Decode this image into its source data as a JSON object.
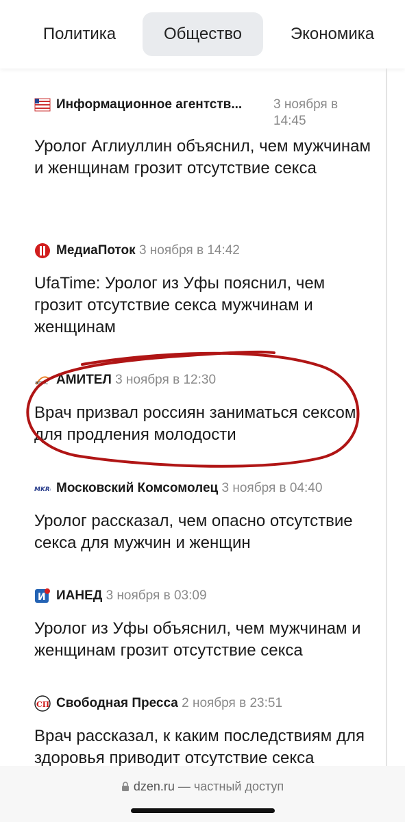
{
  "tabs": [
    {
      "label": "Политика"
    },
    {
      "label": "Общество",
      "active": true
    },
    {
      "label": "Экономика"
    }
  ],
  "news": [
    {
      "source": "Информационное агентств...",
      "time": "3 ноября в 14:45",
      "title": "Уролог Аглиуллин объяснил, чем мужчинам и женщинам грозит отсутствие секса"
    },
    {
      "source": "МедиаПоток",
      "time": "3 ноября в 14:42",
      "title": "UfaTime: Уролог из Уфы пояснил, чем грозит отсутствие секса мужчинам и женщинам"
    },
    {
      "source": "АМИТЕЛ",
      "time": "3 ноября в 12:30",
      "title": "Врач призвал россиян заниматься сексом для продления молодости",
      "logo_text": "amic"
    },
    {
      "source": "Московский Комсомолец",
      "time": "3 ноября в 04:40",
      "title": "Уролог рассказал, чем опасно отсутствие секса для мужчин и женщин",
      "logo_text": "MKRU"
    },
    {
      "source": "ИАНЕД",
      "time": "3 ноября в 03:09",
      "title": "Уролог из Уфы объяснил, чем мужчинам и женщинам грозит отсутствие секса",
      "logo_text": "И"
    },
    {
      "source": "Свободная Пресса",
      "time": "2 ноября в 23:51",
      "title": "Врач рассказал, к каким последствиям для здоровья приводит отсутствие секса",
      "logo_text": "СП"
    }
  ],
  "bottom": {
    "host": "dzen.ru",
    "access": " — частный доступ"
  },
  "colors": {
    "annotation": "#b01515",
    "tab_active_bg": "#e9ebee"
  }
}
